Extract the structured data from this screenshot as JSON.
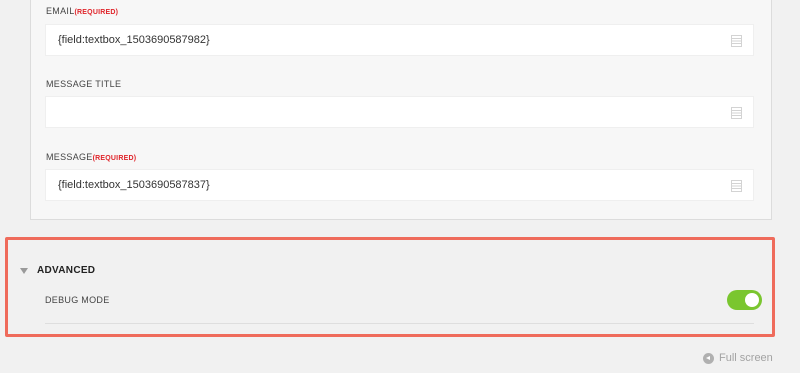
{
  "fields": [
    {
      "label": "EMAIL",
      "required": "(REQUIRED)",
      "value": "{field:textbox_1503690587982}",
      "icon": "merge-tag-icon"
    },
    {
      "label": "MESSAGE TITLE",
      "required": "",
      "value": "",
      "icon": "merge-tag-icon"
    },
    {
      "label": "MESSAGE",
      "required": "(REQUIRED)",
      "value": "{field:textbox_1503690587837}",
      "icon": "merge-tag-icon"
    }
  ],
  "advanced": {
    "title": "ADVANCED",
    "debug_label": "DEBUG MODE",
    "debug_enabled": true,
    "highlight_color": "#ef6b5b",
    "toggle_color": "#7ac62f"
  },
  "footer": {
    "fullscreen_label": "Full screen",
    "icon": "arrow-left-circle-icon"
  }
}
